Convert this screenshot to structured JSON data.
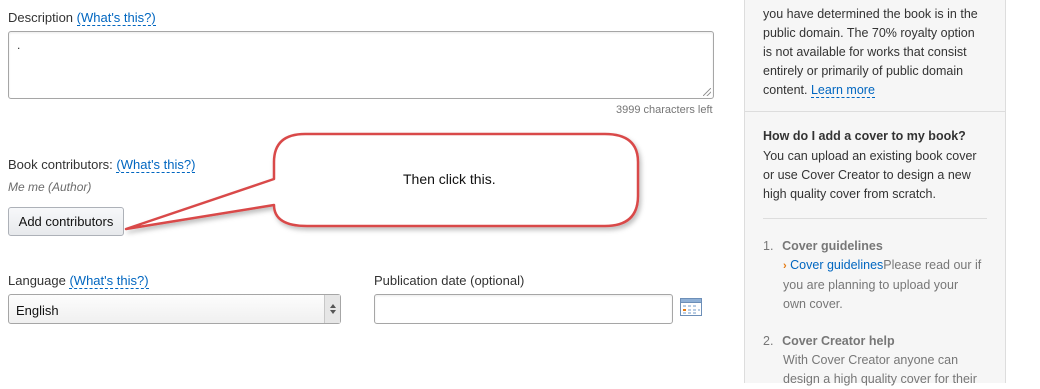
{
  "description": {
    "label": "Description",
    "help": "(What's this?)",
    "value": ".",
    "counter": "3999 characters left"
  },
  "contributors": {
    "label": "Book contributors:",
    "help": "(What's this?)",
    "list_entry": "Me me (Author)",
    "add_button": "Add contributors"
  },
  "language": {
    "label": "Language",
    "help": "(What's this?)",
    "selected": "English"
  },
  "publication_date": {
    "label": "Publication date (optional)",
    "value": ""
  },
  "callout": {
    "text": "Then click this.",
    "color": "#d94a4a"
  },
  "sidebar": {
    "top_lines": [
      "you have determined the book is in the",
      "public domain. The 70% royalty option",
      "is not available for works that consist",
      "entirely or primarily of public domain",
      "content."
    ],
    "learn_more": "Learn more",
    "cover_heading": "How do I add a cover to my book?",
    "cover_lines": [
      "You can upload an existing book cover",
      "or use Cover Creator to design a new",
      "high quality cover from scratch."
    ],
    "steps": [
      {
        "num": "1.",
        "title": "Cover guidelines",
        "link": "Cover guidelines",
        "lines": [
          "Please read our if",
          "you are planning to upload your",
          "own cover."
        ]
      },
      {
        "num": "2.",
        "title": "Cover Creator help",
        "lines": [
          "With Cover Creator anyone can",
          "design a high quality cover for their"
        ]
      }
    ]
  }
}
